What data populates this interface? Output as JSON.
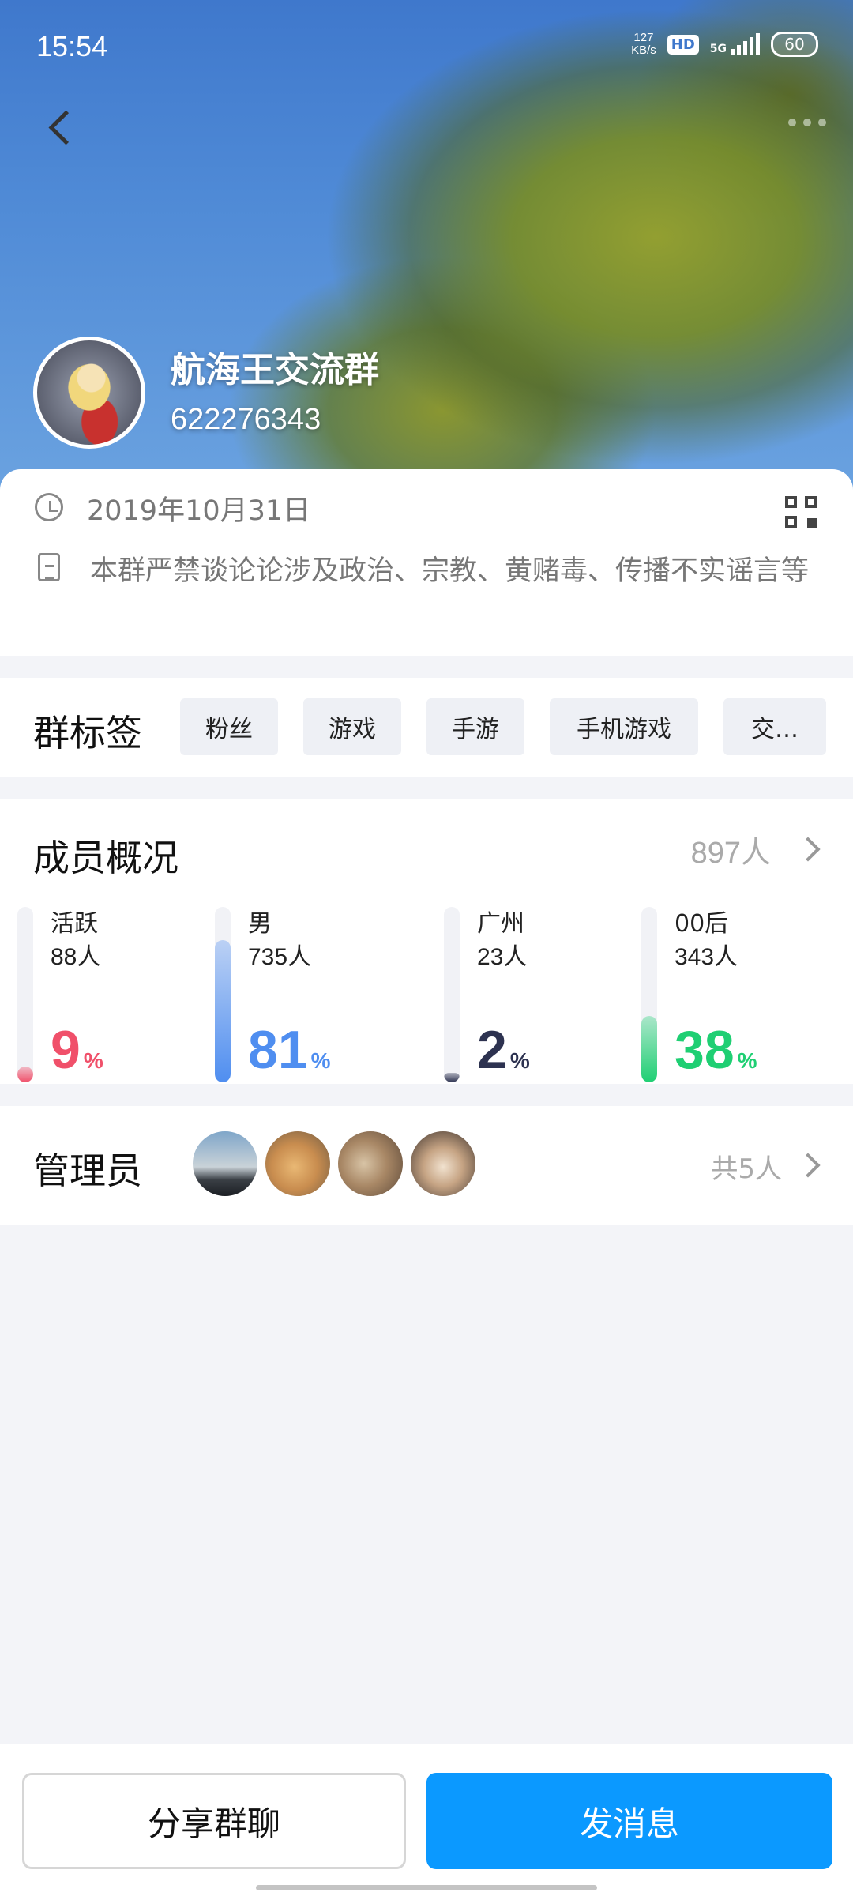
{
  "status_bar": {
    "time": "15:54",
    "net_speed_value": "127",
    "net_speed_unit": "KB/s",
    "hd": "HD",
    "network": "5G",
    "battery": "60"
  },
  "group": {
    "name": "航海王交流群",
    "id": "622276343"
  },
  "info": {
    "created_date": "2019年10月31日",
    "description": "本群严禁谈论论涉及政治、宗教、黄赌毒、传播不实谣言等"
  },
  "tags_section": {
    "title": "群标签",
    "tags": [
      "粉丝",
      "游戏",
      "手游",
      "手机游戏",
      "交…"
    ]
  },
  "members_section": {
    "title": "成员概况",
    "count": "897人",
    "stats": [
      {
        "label": "活跃",
        "value": "88人",
        "percent": "9",
        "unit": "%",
        "fill": 0.09,
        "color": "#f0506a"
      },
      {
        "label": "男",
        "value": "735人",
        "percent": "81",
        "unit": "%",
        "fill": 0.81,
        "color": "#4f8ef0"
      },
      {
        "label": "广州",
        "value": "23人",
        "percent": "2",
        "unit": "%",
        "fill": 0.02,
        "color": "#2d3250"
      },
      {
        "label": "00后",
        "value": "343人",
        "percent": "38",
        "unit": "%",
        "fill": 0.38,
        "color": "#1fcf73"
      }
    ]
  },
  "admins_section": {
    "title": "管理员",
    "total": "共5人"
  },
  "actions": {
    "share_label": "分享群聊",
    "send_label": "发消息"
  },
  "colors": {
    "primary": "#0b99ff",
    "active": "#f0506a",
    "male": "#4f8ef0",
    "city": "#2d3250",
    "post00": "#1fcf73"
  }
}
